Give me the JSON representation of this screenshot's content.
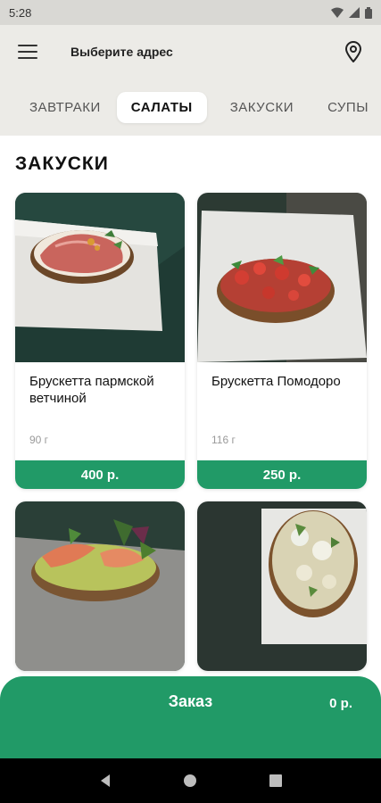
{
  "status_bar": {
    "time": "5:28"
  },
  "header": {
    "address_label": "Выберите адрес"
  },
  "tabs": [
    {
      "label": "ЗАВТРАКИ"
    },
    {
      "label": "САЛАТЫ"
    },
    {
      "label": "ЗАКУСКИ"
    },
    {
      "label": "СУПЫ"
    }
  ],
  "active_tab": "САЛАТЫ",
  "section": {
    "title": "ЗАКУСКИ"
  },
  "products": [
    {
      "name": "Брускетта пармской ветчиной",
      "weight": "90 г",
      "price": "400 р."
    },
    {
      "name": "Брускетта Помодоро",
      "weight": "116 г",
      "price": "250 р."
    }
  ],
  "order": {
    "label": "Заказ",
    "total": "0 р."
  },
  "colors": {
    "accent": "#219a67",
    "header_bg": "#ecebe7",
    "status_bg": "#d9d8d4"
  }
}
